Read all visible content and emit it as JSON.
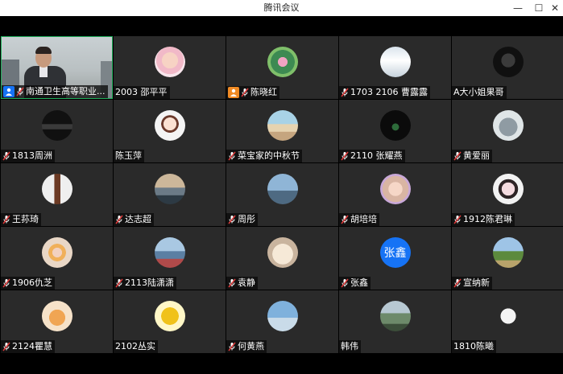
{
  "window": {
    "title": "腾讯会议",
    "minimize": "—",
    "maximize": "☐",
    "close": "✕"
  },
  "colors": {
    "tile_bg": "#2a2a2a",
    "active_border": "#1fae5a",
    "host_badge": "#1673f5",
    "cohost_badge": "#f08a24",
    "mic_muted": "#e03a3a",
    "text_avatar": "#1673f5"
  },
  "participants": [
    {
      "name": "南通卫生高等职业...",
      "mic": "muted",
      "badge": "host",
      "avatar": "video",
      "active": true
    },
    {
      "name": "2003 邵平平",
      "mic": "none",
      "avatar": "baby-photo"
    },
    {
      "name": "陈晓红",
      "mic": "muted",
      "badge": "cohost",
      "avatar": "lotus-photo"
    },
    {
      "name": "1703 2106 曹露露",
      "mic": "muted",
      "avatar": "woman-white-photo"
    },
    {
      "name": "A大小姐果哥",
      "mic": "none",
      "avatar": "dark-portrait-photo"
    },
    {
      "name": "1813周洲",
      "mic": "muted",
      "avatar": "car-photo"
    },
    {
      "name": "陈玉萍",
      "mic": "none",
      "avatar": "cartoon-girl-photo"
    },
    {
      "name": "菜宝家的中秋节",
      "mic": "muted",
      "avatar": "beach-hat-photo"
    },
    {
      "name": "2110 张耀燕",
      "mic": "muted",
      "avatar": "night-photo"
    },
    {
      "name": "黄爱丽",
      "mic": "muted",
      "avatar": "totoro-photo"
    },
    {
      "name": "王荪琦",
      "mic": "muted",
      "avatar": "hair-photo"
    },
    {
      "name": "达志超",
      "mic": "muted",
      "avatar": "sunset-sea-photo"
    },
    {
      "name": "周彤",
      "mic": "muted",
      "avatar": "sky-girl-photo"
    },
    {
      "name": "胡培培",
      "mic": "muted",
      "avatar": "smiling-girl-photo"
    },
    {
      "name": "1912陈君琳",
      "mic": "muted",
      "avatar": "anime-girl-photo"
    },
    {
      "name": "1906仇芝",
      "mic": "muted",
      "avatar": "flowers-girl-photo"
    },
    {
      "name": "2113陆潇潇",
      "mic": "muted",
      "avatar": "lake-photo"
    },
    {
      "name": "袁静",
      "mic": "muted",
      "avatar": "cartoon-bears-photo"
    },
    {
      "name": "张鑫",
      "mic": "muted",
      "avatar": "text",
      "avatar_text": "张鑫"
    },
    {
      "name": "宣纳新",
      "mic": "muted",
      "avatar": "field-photo"
    },
    {
      "name": "2124瞿慧",
      "mic": "muted",
      "avatar": "hamster-photo"
    },
    {
      "name": "2102丛实",
      "mic": "none",
      "avatar": "cartoon-fish-photo"
    },
    {
      "name": "何黄燕",
      "mic": "muted",
      "avatar": "blue-sky-photo"
    },
    {
      "name": "韩伟",
      "mic": "none",
      "avatar": "landscape-photo"
    },
    {
      "name": "1810陈曦",
      "mic": "none",
      "avatar": "cup-photo"
    }
  ]
}
